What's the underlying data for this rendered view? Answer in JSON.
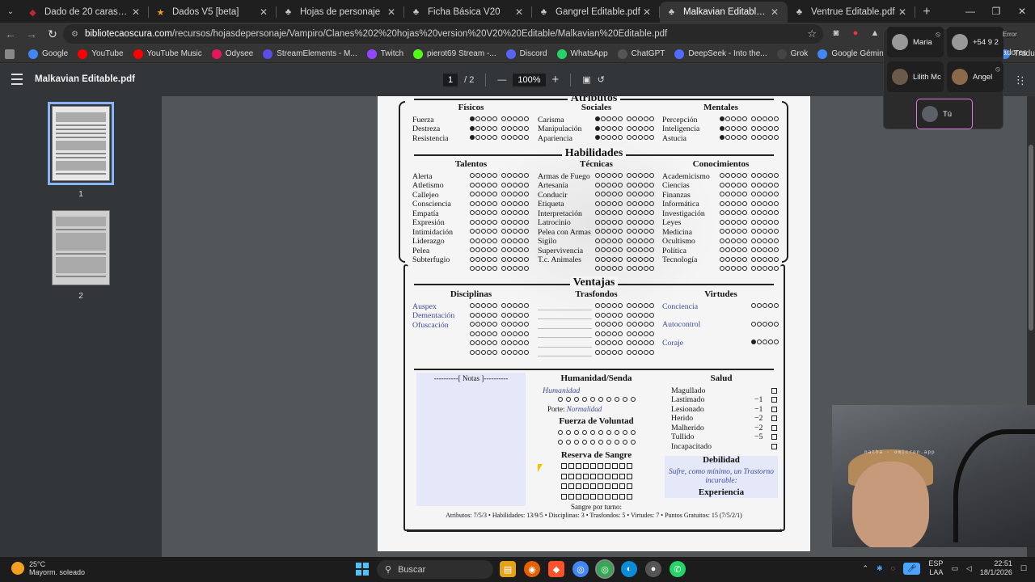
{
  "tabs": [
    {
      "title": "Dado de 20 caras - Crea un dado",
      "icon": "d20-favicon-icon",
      "color": "#c0263a"
    },
    {
      "title": "Dados V5 [beta]",
      "icon": "star-favicon-icon",
      "color": "#f0a020"
    },
    {
      "title": "Hojas de personaje",
      "icon": "vampire-favicon-icon",
      "color": "#cccccc"
    },
    {
      "title": "Ficha Básica V20",
      "icon": "vampire-favicon-icon",
      "color": "#cccccc"
    },
    {
      "title": "Gangrel Editable.pdf",
      "icon": "vampire-favicon-icon",
      "color": "#cccccc"
    },
    {
      "title": "Malkavian Editable.pdf",
      "icon": "vampire-favicon-icon",
      "color": "#cccccc",
      "active": true
    },
    {
      "title": "Ventrue Editable.pdf",
      "icon": "vampire-favicon-icon",
      "color": "#cccccc"
    }
  ],
  "address": {
    "host": "bibliotecaoscura.com",
    "path": "/recursos/hojasdepersonaje/Vampiro/Clanes%202%20hojas%20version%20V20%20Editable/Malkavian%20Editable.pdf"
  },
  "bookmarks": [
    {
      "label": "Google",
      "color": "#4285f4"
    },
    {
      "label": "YouTube",
      "color": "#ff0000"
    },
    {
      "label": "YouTube Music",
      "color": "#ff0000"
    },
    {
      "label": "Odysee",
      "color": "#e5175a"
    },
    {
      "label": "StreamElements - M...",
      "color": "#5b4ee6"
    },
    {
      "label": "Twitch",
      "color": "#9146ff"
    },
    {
      "label": "pierot69 Stream -...",
      "color": "#53fc18"
    },
    {
      "label": "Discord",
      "color": "#5865f2"
    },
    {
      "label": "WhatsApp",
      "color": "#25d366"
    },
    {
      "label": "ChatGPT",
      "color": "#555555"
    },
    {
      "label": "DeepSeek - Into the...",
      "color": "#4d6bfe"
    },
    {
      "label": "Grok",
      "color": "#444444"
    },
    {
      "label": "Google Géminis",
      "color": "#4285f4"
    },
    {
      "label": "Bolt AI builder: Web...",
      "color": "#222222"
    },
    {
      "label": "Traducir",
      "color": "#4285f4"
    }
  ],
  "bookmarks_more": "rcadores",
  "pdf": {
    "title": "Malkavian Editable.pdf",
    "page": "1",
    "pages": "/ 2",
    "zoom": "100%",
    "thumbs": [
      "1",
      "2"
    ]
  },
  "sheet": {
    "atributos": "Atributos",
    "fisicos": "Físicos",
    "sociales": "Sociales",
    "mentales": "Mentales",
    "fis_items": [
      "Fuerza",
      "Destreza",
      "Resistencia"
    ],
    "soc_items": [
      "Carisma",
      "Manipulación",
      "Apariencia"
    ],
    "men_items": [
      "Percepción",
      "Inteligencia",
      "Astucia"
    ],
    "habilidades": "Habilidades",
    "talentos": "Talentos",
    "tecnicas": "Técnicas",
    "conocimientos": "Conocimientos",
    "tal_items": [
      "Alerta",
      "Atletismo",
      "Callejeo",
      "Consciencia",
      "Empatía",
      "Expresión",
      "Intimidación",
      "Liderazgo",
      "Pelea",
      "Subterfugio",
      ""
    ],
    "tec_items": [
      "Armas de Fuego",
      "Artesanía",
      "Conducir",
      "Etiqueta",
      "Interpretación",
      "Latrocinio",
      "Pelea con Armas",
      "Sigilo",
      "Supervivencia",
      "T.c. Animales",
      ""
    ],
    "con_items": [
      "Academicismo",
      "Ciencias",
      "Finanzas",
      "Informática",
      "Investigación",
      "Leyes",
      "Medicina",
      "Ocultismo",
      "Política",
      "Tecnología",
      ""
    ],
    "ventajas": "Ventajas",
    "disciplinas": "Disciplinas",
    "trasfondos": "Trasfondos",
    "virtudes": "Virtudes",
    "disc_items": [
      "Auspex",
      "Dementación",
      "Ofuscación",
      "",
      "",
      ""
    ],
    "virt_items": [
      "Conciencia",
      "Autocontrol",
      "Coraje"
    ],
    "notas": "----------[ Notas ]----------",
    "humanidad": "Humanidad/Senda",
    "humanidad_val": "Humanidad",
    "porte_label": "Porte:",
    "porte_val": "Normalidad",
    "voluntad": "Fuerza de Voluntad",
    "sangre": "Reserva de Sangre",
    "sangre_turno": "Sangre por turno:",
    "salud": "Salud",
    "salud_items": [
      {
        "name": "Magullado",
        "mod": ""
      },
      {
        "name": "Lastimado",
        "mod": "−1"
      },
      {
        "name": "Lesionado",
        "mod": "−1"
      },
      {
        "name": "Herido",
        "mod": "−2"
      },
      {
        "name": "Malherido",
        "mod": "−2"
      },
      {
        "name": "Tullido",
        "mod": "−5"
      },
      {
        "name": "Incapacitado",
        "mod": ""
      }
    ],
    "debilidad": "Debilidad",
    "debilidad_text": "Sufre, como mínimo, un Trastorno incurable:",
    "experiencia": "Experiencia",
    "footer": "Atributos: 7/5/3 • Habilidades: 13/9/5 • Disciplinas: 3 • Trasfondos: 5 • Virtudes: 7 • Puntos Gratuitos: 15 (7/5/2/1)"
  },
  "meet": {
    "participants": [
      {
        "name": "Maria",
        "muted": true
      },
      {
        "name": "+54 9 2",
        "muted": false
      },
      {
        "name": "Lilith Mc",
        "muted": false
      },
      {
        "name": "Angel",
        "muted": true
      }
    ],
    "self": "Tú",
    "error_badge": "Error"
  },
  "webcam_caption": "natha · omicron.app",
  "taskbar": {
    "weather_temp": "25°C",
    "weather_desc": "Mayorm. soleado",
    "search_placeholder": "Buscar",
    "lang": "ESP",
    "lang2": "LAA",
    "time": "22:51",
    "date": "18/1/2026"
  }
}
